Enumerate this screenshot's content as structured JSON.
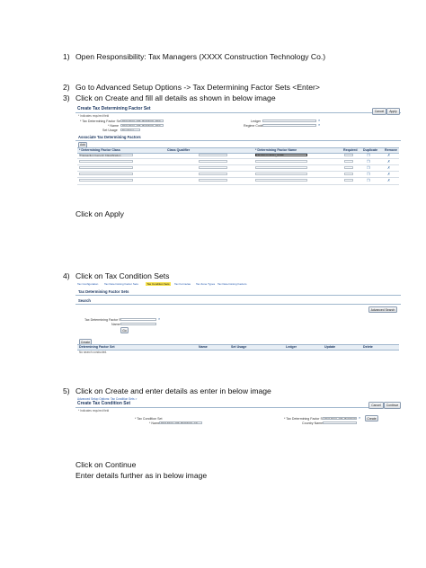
{
  "steps": [
    {
      "num": "1)",
      "text": "Open Responsibility: Tax Managers (XXXX Construction Technology Co.)"
    },
    {
      "num": "2)",
      "text": "Go to Advanced Setup Options -> Tax Determining Factor Sets <Enter>"
    },
    {
      "num": "3)",
      "text": "Click on Create  and fill all details as shown in below image"
    },
    {
      "num": "4)",
      "text": "Click on Tax Condition Sets"
    },
    {
      "num": "5)",
      "text": "Click on Create and enter details as enter in below image"
    }
  ],
  "notes": {
    "click_apply": "Click on Apply",
    "click_continue": "Click on Continue",
    "enter_further": "Enter details further as in below image"
  },
  "shot1": {
    "title": "Create Tax Determining Factor Set",
    "required_hint": "* Indicates required field",
    "buttons": {
      "cancel": "Cancel",
      "apply": "Apply"
    },
    "labels": {
      "set_code": "* Tax Determining Factor Set",
      "name": "* Name",
      "set_usage": "Set Usage",
      "ledger": "Ledger",
      "regime_code": "Regime Code"
    },
    "values": {
      "set_code": "DET DECL-WS_BONNUS_RFG",
      "name": "DET DECL-WS_BONNUS_RFG",
      "set_usage": "Tax Rules"
    },
    "section_title": "Associate Tax Determining Factors",
    "add_label": "Add",
    "columns": [
      "* Determining Factor Class",
      "Class Qualifier",
      "* Determining Factor Name",
      "Required",
      "Duplicate",
      "Remove"
    ],
    "first_row_class": "Transaction Generic Classification",
    "first_row_name": "TRANSACTION_TYPE"
  },
  "shot2": {
    "tabs": [
      "Tax Configuration",
      "Tax Determining Factor Sets",
      "Tax Condition Sets",
      "Tax Formulas",
      "Tax Zone Types",
      "Tax Determining Factors"
    ],
    "active_tab": 2,
    "title": "Tax Determining Factor Sets",
    "search_title": "Search",
    "advanced_search": "Advanced Search",
    "labels": {
      "set": "Tax Determining Factor Set",
      "name": "Name"
    },
    "go": "Go",
    "create": "Create",
    "columns": [
      "Determining Factor Set",
      "Name",
      "Set Usage",
      "Ledger",
      "Update",
      "Delete"
    ],
    "empty_msg": "No search conducted."
  },
  "shot3": {
    "breadcrumb": "Advanced Setup Options: Tax Condition Sets >",
    "title": "Create Tax Condition Set",
    "required_hint": "* Indicates required field",
    "buttons": {
      "cancel": "Cancel",
      "continue": "Continue",
      "create": "Create"
    },
    "labels": {
      "condition_set": "* Tax Condition Set",
      "name": "* Name",
      "factor_set": "* Tax Determining Factor Set",
      "country": "Country Name"
    },
    "values": {
      "name": "DET DECL-WS_BONNUS_CS",
      "factor_set": "DET DECL-WS_BONNUS_RFG"
    }
  }
}
